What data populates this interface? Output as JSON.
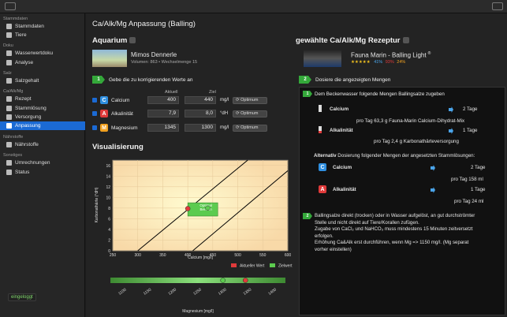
{
  "window": {
    "title_buttons": [
      "sidebar-toggle",
      "inspector-toggle"
    ]
  },
  "sidebar": {
    "sections": [
      {
        "header": "Stammdaten",
        "items": [
          "Stammdaten",
          "Tiere"
        ]
      },
      {
        "header": "Doku",
        "items": [
          "Wasserwertdoku",
          "Analyse"
        ]
      },
      {
        "header": "Salz",
        "items": [
          "Salzgehalt"
        ]
      },
      {
        "header": "Ca/Alk/Mg",
        "items": [
          "Rezept",
          "Stammlösung",
          "Versorgung",
          "Anpassung"
        ]
      },
      {
        "header": "Nährstoffe",
        "items": [
          "Nährstoffe"
        ]
      },
      {
        "header": "Sonstiges",
        "items": [
          "Umrechnungen",
          "Status"
        ]
      }
    ],
    "active_item": "Anpassung",
    "login_status": "eingeloggt"
  },
  "main": {
    "title": "Ca/Alk/Mg Anpassung (Balling)",
    "aquarium": {
      "header": "Aquarium",
      "name": "Mimos Dennerle",
      "details": "Volumen: 863 • Wechselmenge 15"
    },
    "recipe": {
      "header": "gewählte Ca/Alk/Mg Rezeptur",
      "name": "Fauna Marin - Balling Light",
      "registered_mark": "®",
      "stars": "★★★★★",
      "pct1": "41%",
      "pct2": "93%",
      "pct3": "24%"
    },
    "step1": {
      "num": "1",
      "text": "Gebe die zu korrigierenden Werte an"
    },
    "step2": {
      "num": "2",
      "text": "Dosiere die angezeigten Mengen"
    },
    "values_header": {
      "current": "Aktuell",
      "target": "Ziel"
    },
    "rows": [
      {
        "badge": "C",
        "badge_color": "#2f8fe0",
        "label": "Calcium",
        "current": "400",
        "target": "440",
        "unit": "mg/l",
        "button": "⟳ Optimum"
      },
      {
        "badge": "A",
        "badge_color": "#e03a3a",
        "label": "Alkalinität",
        "current": "7,9",
        "target": "8,0",
        "unit": "°dH",
        "button": "⟳ Optimum"
      },
      {
        "badge": "M",
        "badge_color": "#f0a020",
        "label": "Magnesium",
        "current": "1345",
        "target": "1300",
        "unit": "mg/l",
        "button": "⟳ Optimum"
      }
    ],
    "visualisation": {
      "header": "Visualisierung",
      "ylabel": "Karbonathärte (°dH)",
      "xlabel": "Calcium [mg/l]",
      "zone_label_1": "Optimal",
      "zone_label_2": "Bereich",
      "legend_current": "Aktueller Wert",
      "legend_target": "Zielwert",
      "mg_label": "Magnesium [mg/l]",
      "mg_ticks": [
        "1100",
        "1150",
        "1200",
        "1250",
        "1300",
        "1350",
        "1400"
      ]
    },
    "dosing": {
      "intro_num": "1",
      "intro": "Dem Beckenwasser folgende Mengen Ballingsalze zugeben",
      "salts": [
        {
          "label": "Calcium",
          "amount": "2 Tage",
          "detail": "pro Tag 63,3 g Fauna-Marin Calcium-Dihydrat-Mix",
          "color": "#ffffff"
        },
        {
          "label": "Alkalinität",
          "amount": "1 Tage",
          "detail": "pro Tag 2,4 g Karbonathärteversorgung",
          "color": "#ffffff"
        }
      ],
      "alt_prefix": "Alternativ",
      "alt_text": "Dosierung folgender Mengen der angesetzten Stammlösungen:",
      "solutions": [
        {
          "badge": "C",
          "badge_color": "#2f8fe0",
          "label": "Calcium",
          "amount": "2 Tage",
          "detail": "pro Tag 158 ml"
        },
        {
          "badge": "A",
          "badge_color": "#e03a3a",
          "label": "Alkalinität",
          "amount": "1 Tage",
          "detail": "pro Tag 24 ml"
        }
      ],
      "note_num": "2",
      "note_lines": [
        "Ballingsalze direkt (trocken) oder in Wasser aufgelöst, an gut durchströmter",
        "Stelle und nicht direkt auf Tiere/Korallen zufügen.",
        "Zugabe von CaCl₂ und NaHCO₃ muss mindestens 15 Minuten zeitversetzt",
        "erfolgen.",
        "Erhöhung Ca&Alk erst durchführen, wenn Mg => 1150 mg/l. (Mg separat",
        "vorher einstellen)"
      ]
    }
  },
  "chart_data": {
    "type": "scatter",
    "title": "",
    "xlabel": "Calcium [mg/l]",
    "ylabel": "Karbonathärte (°dH)",
    "xlim": [
      250,
      600
    ],
    "ylim": [
      0,
      17
    ],
    "x_ticks": [
      250,
      300,
      350,
      400,
      450,
      500,
      550,
      600
    ],
    "y_ticks": [
      0,
      2,
      4,
      6,
      8,
      10,
      12,
      14,
      16
    ],
    "series": [
      {
        "name": "Aktueller Wert",
        "x": [
          400
        ],
        "y": [
          7.9
        ],
        "color": "#e03a3a"
      },
      {
        "name": "Zielwert",
        "x": [
          440
        ],
        "y": [
          8.0
        ],
        "color": "#5ccb4f"
      }
    ],
    "diagonal_lines": [
      {
        "x": [
          300,
          520
        ],
        "y": [
          0,
          17
        ]
      },
      {
        "x": [
          410,
          600
        ],
        "y": [
          0,
          15
        ]
      }
    ],
    "optimal_zone": {
      "x": [
        400,
        460
      ],
      "y": [
        6.5,
        9.0
      ]
    },
    "magnesium": {
      "min": 1075,
      "max": 1425,
      "current": 1345,
      "target": 1300
    }
  }
}
